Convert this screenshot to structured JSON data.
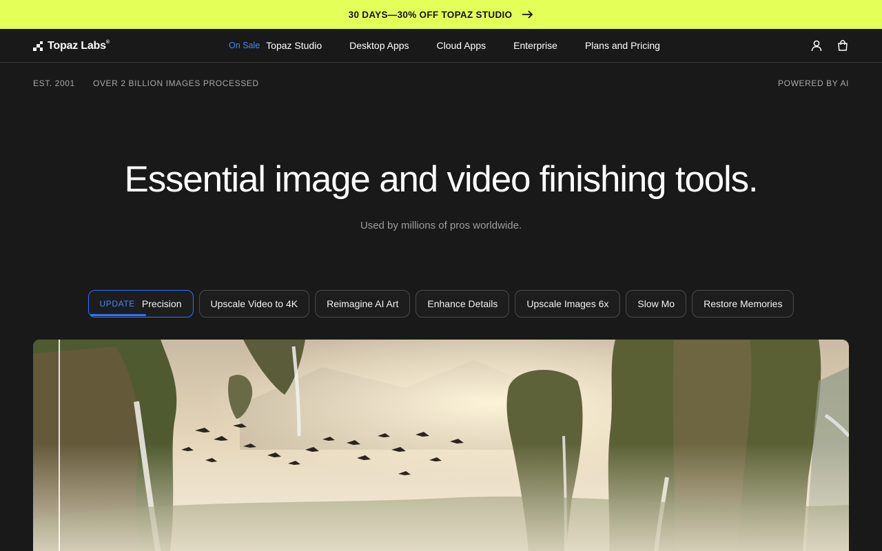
{
  "promo": {
    "text": "30 DAYS—30% OFF TOPAZ STUDIO",
    "icon": "arrow-right-icon"
  },
  "brand": {
    "name": "Topaz Labs",
    "mark": "®"
  },
  "nav": {
    "items": [
      {
        "label": "Topaz Studio",
        "badge": "On Sale"
      },
      {
        "label": "Desktop Apps"
      },
      {
        "label": "Cloud Apps"
      },
      {
        "label": "Enterprise"
      },
      {
        "label": "Plans and Pricing"
      }
    ],
    "icons": [
      "account-icon",
      "cart-icon"
    ]
  },
  "meta": {
    "established": "EST. 2001",
    "stat": "OVER 2 BILLION IMAGES PROCESSED",
    "tagline": "POWERED BY AI"
  },
  "hero": {
    "title": "Essential image and video finishing tools.",
    "subtitle": "Used by millions of pros worldwide."
  },
  "tabs": [
    {
      "badge": "UPDATE",
      "label": "Precision",
      "active": true,
      "progress": 0.55
    },
    {
      "label": "Upscale Video to 4K"
    },
    {
      "label": "Reimagine AI Art"
    },
    {
      "label": "Enhance Details"
    },
    {
      "label": "Upscale Images 6x"
    },
    {
      "label": "Slow Mo"
    },
    {
      "label": "Restore Memories"
    }
  ],
  "colors": {
    "promo_bg": "#e4ff57",
    "accent": "#2f73ff",
    "page_bg": "#191919"
  }
}
